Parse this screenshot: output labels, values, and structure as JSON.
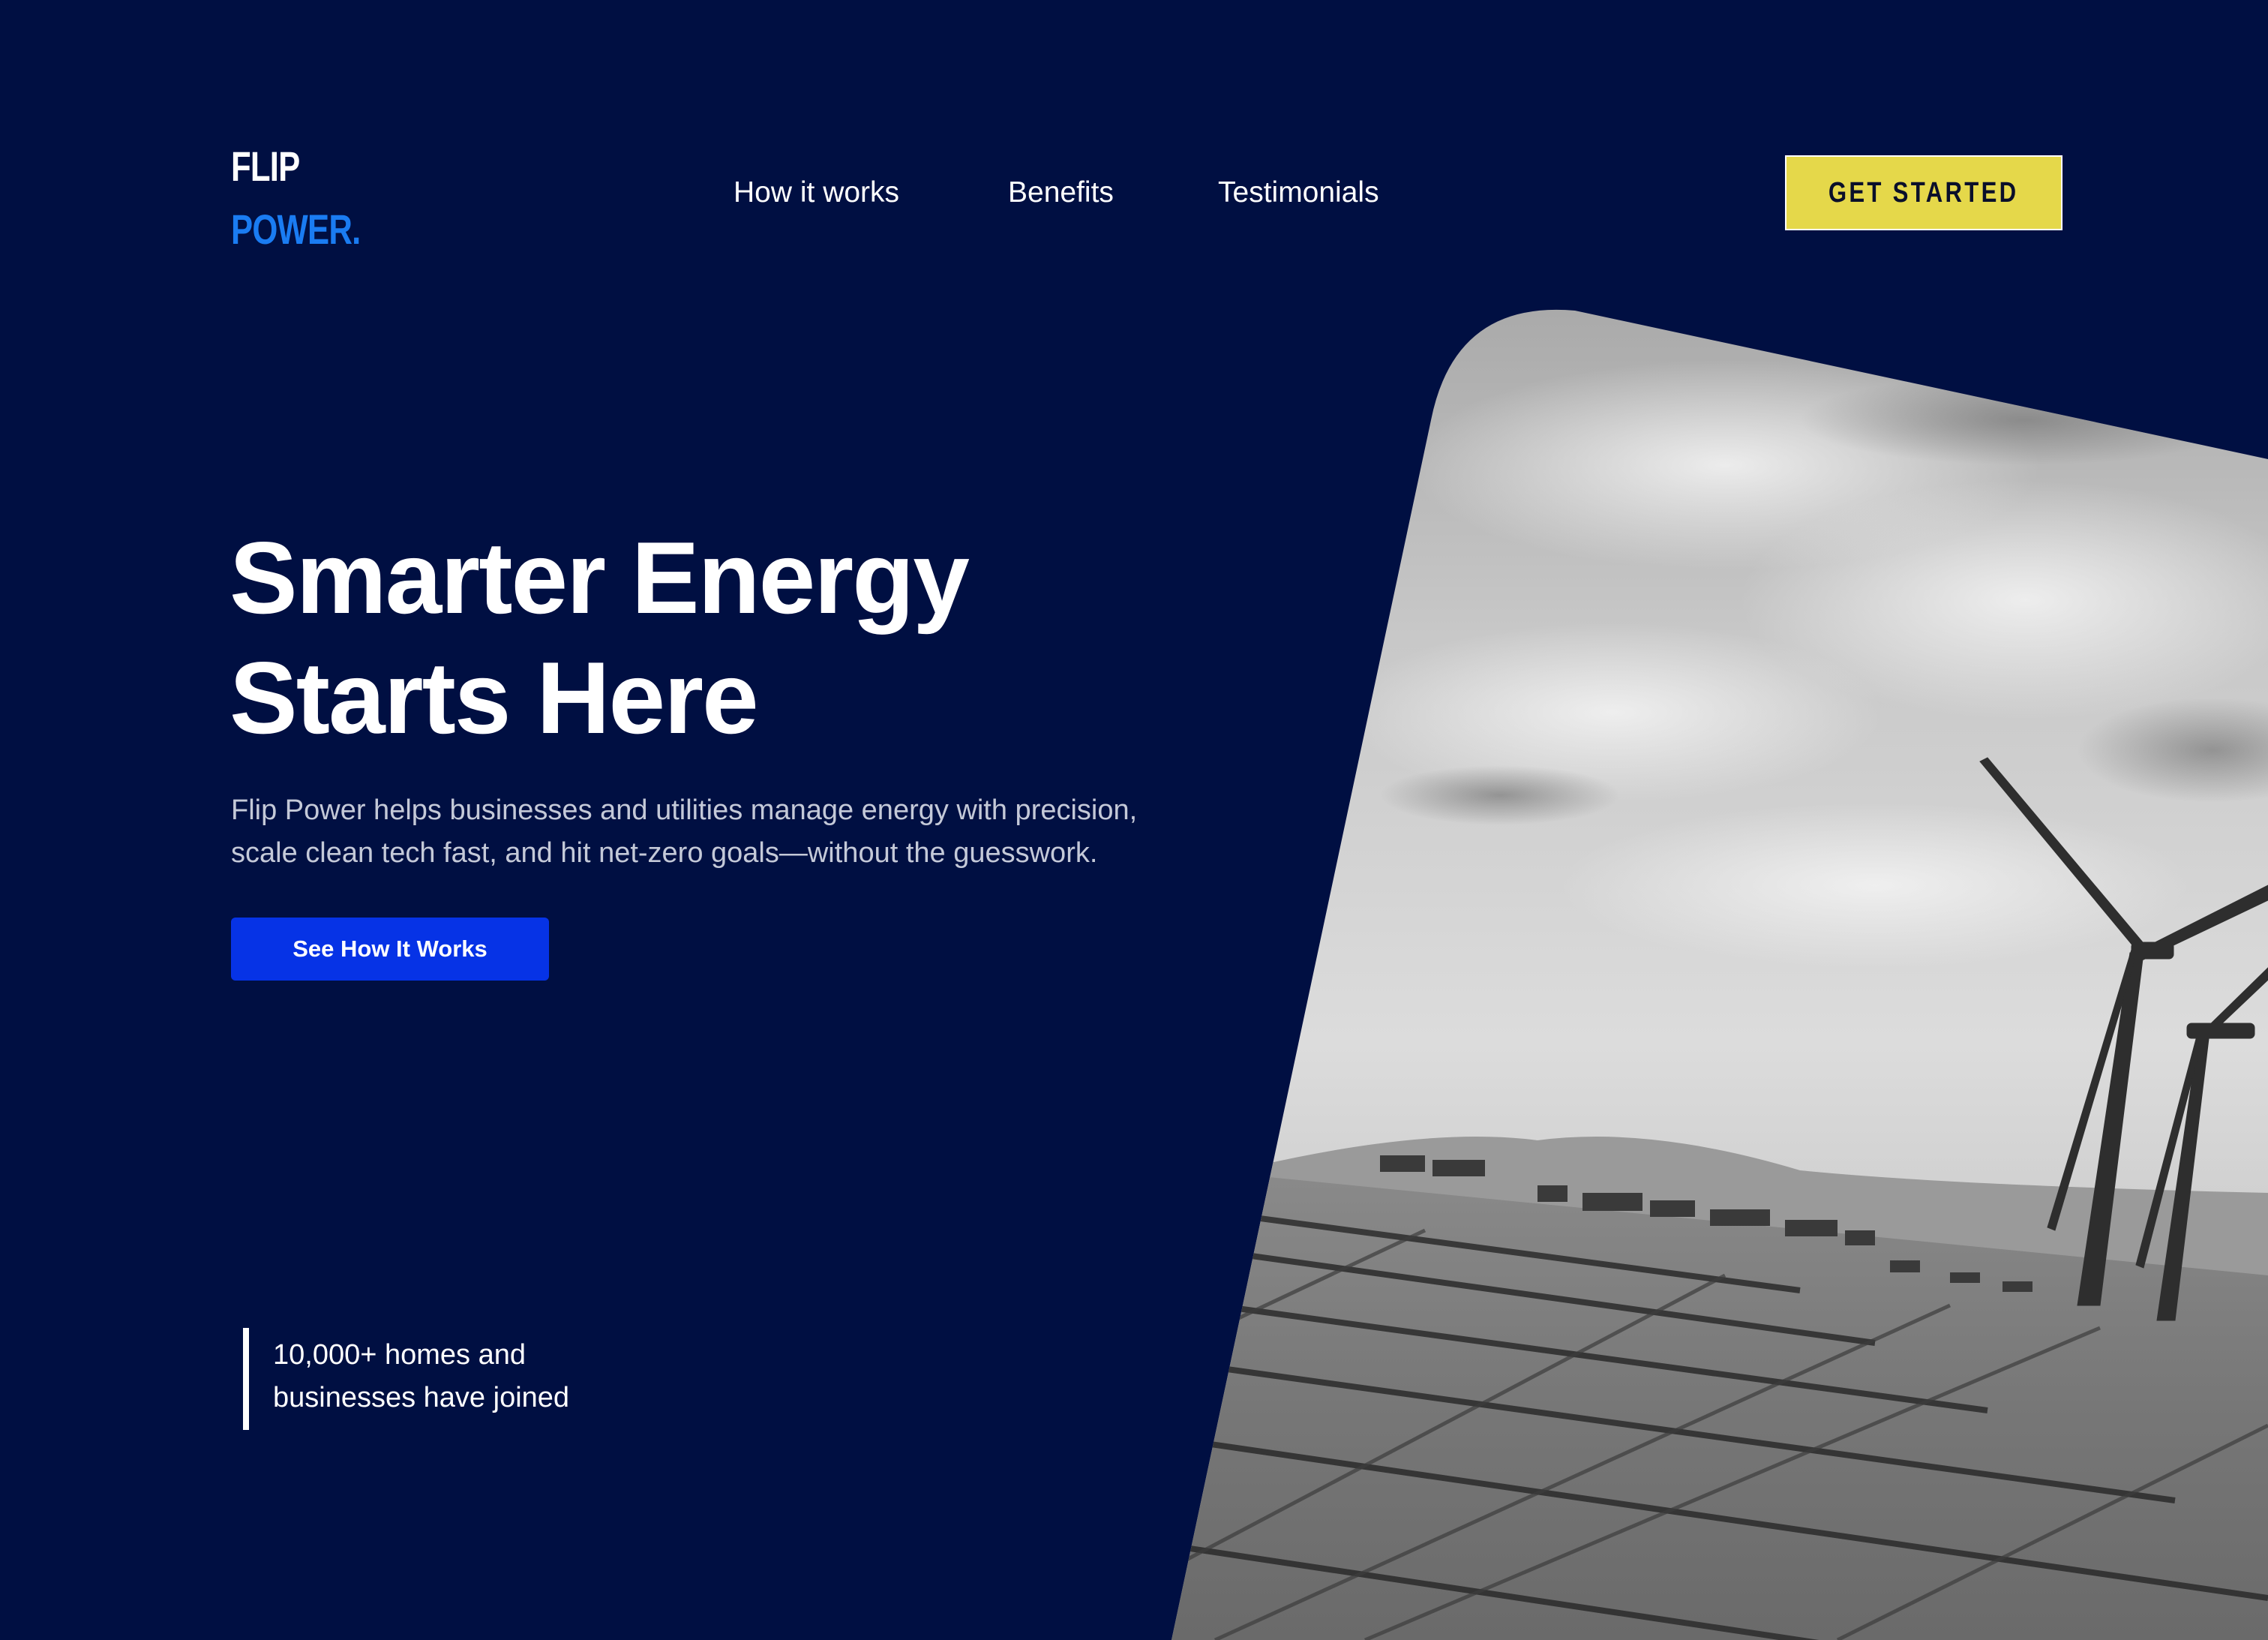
{
  "brand": {
    "line1": "FLIP",
    "line2": "POWER."
  },
  "nav": {
    "items": [
      {
        "label": "How it works"
      },
      {
        "label": "Benefits"
      },
      {
        "label": "Testimonials"
      }
    ],
    "cta_label": "GET STARTED"
  },
  "hero": {
    "headline_line1": "Smarter Energy",
    "headline_line2": "Starts Here",
    "subtitle_line1": "Flip Power helps businesses and utilities manage energy with precision,",
    "subtitle_line2": "scale clean tech fast, and hit net-zero goals—without the guesswork.",
    "button_label": "See How It Works",
    "stat_line1": "10,000+ homes and",
    "stat_line2": "businesses have joined"
  },
  "colors": {
    "background": "#000f42",
    "brand_accent": "#1a7cf2",
    "cta_yellow": "#e5d84a",
    "primary_button": "#0633e6"
  }
}
